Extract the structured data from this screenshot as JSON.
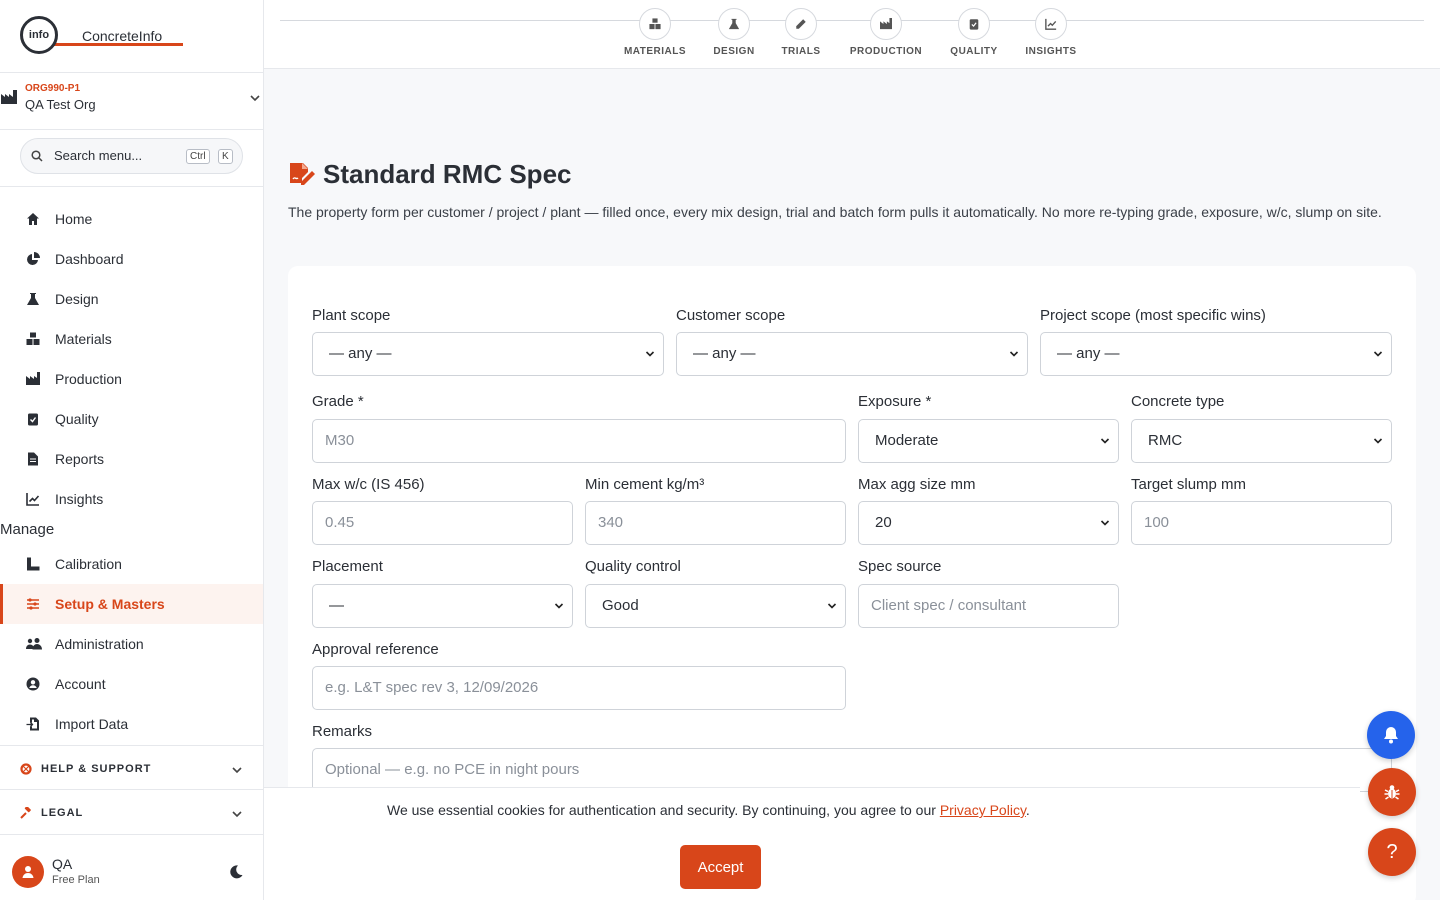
{
  "brand": {
    "logo_mark": "info",
    "logo_text": "ConcreteInfo"
  },
  "org": {
    "code": "ORG990-P1",
    "name": "QA Test Org"
  },
  "search": {
    "placeholder": "Search menu...",
    "kbd_ctrl": "Ctrl",
    "kbd_k": "K"
  },
  "nav": {
    "home": "Home",
    "dashboard": "Dashboard",
    "design": "Design",
    "materials": "Materials",
    "production": "Production",
    "quality": "Quality",
    "reports": "Reports",
    "insights": "Insights",
    "manage_title": "Manage",
    "calibration": "Calibration",
    "setup": "Setup & Masters",
    "administration": "Administration",
    "account": "Account",
    "import": "Import Data"
  },
  "accordions": {
    "help": "HELP & SUPPORT",
    "legal": "LEGAL"
  },
  "user": {
    "name": "QA",
    "plan": "Free Plan"
  },
  "stepper": [
    "MATERIALS",
    "DESIGN",
    "TRIALS",
    "PRODUCTION",
    "QUALITY",
    "INSIGHTS"
  ],
  "page": {
    "title": "Standard RMC Spec",
    "description": "The property form per customer / project / plant — filled once, every mix design, trial and batch form pulls it automatically. No more re-typing grade, exposure, w/c, slump on site."
  },
  "form": {
    "plant_scope": {
      "label": "Plant scope",
      "value": "— any —"
    },
    "customer_scope": {
      "label": "Customer scope",
      "value": "— any —"
    },
    "project_scope": {
      "label": "Project scope (most specific wins)",
      "value": "— any —"
    },
    "grade": {
      "label": "Grade *",
      "placeholder": "M30"
    },
    "exposure": {
      "label": "Exposure *",
      "value": "Moderate"
    },
    "concrete_type": {
      "label": "Concrete type",
      "value": "RMC"
    },
    "max_wc": {
      "label": "Max w/c (IS 456)",
      "placeholder": "0.45"
    },
    "min_cement": {
      "label": "Min cement kg/m³",
      "placeholder": "340"
    },
    "max_agg": {
      "label": "Max agg size mm",
      "value": "20"
    },
    "target_slump": {
      "label": "Target slump mm",
      "placeholder": "100"
    },
    "placement": {
      "label": "Placement",
      "value": "—"
    },
    "quality_control": {
      "label": "Quality control",
      "value": "Good"
    },
    "spec_source": {
      "label": "Spec source",
      "placeholder": "Client spec / consultant"
    },
    "approval_ref": {
      "label": "Approval reference",
      "placeholder": "e.g. L&T spec rev 3, 12/09/2026"
    },
    "remarks": {
      "label": "Remarks",
      "placeholder": "Optional — e.g. no PCE in night pours"
    }
  },
  "cookie": {
    "text": "We use essential cookies for authentication and security. By continuing, you agree to our ",
    "link": "Privacy Policy",
    "end": ".",
    "accept": "Accept"
  },
  "fab": {
    "help": "?"
  },
  "colors": {
    "accent": "#d8461a",
    "blue": "#2563eb",
    "text": "#2b2f36"
  }
}
